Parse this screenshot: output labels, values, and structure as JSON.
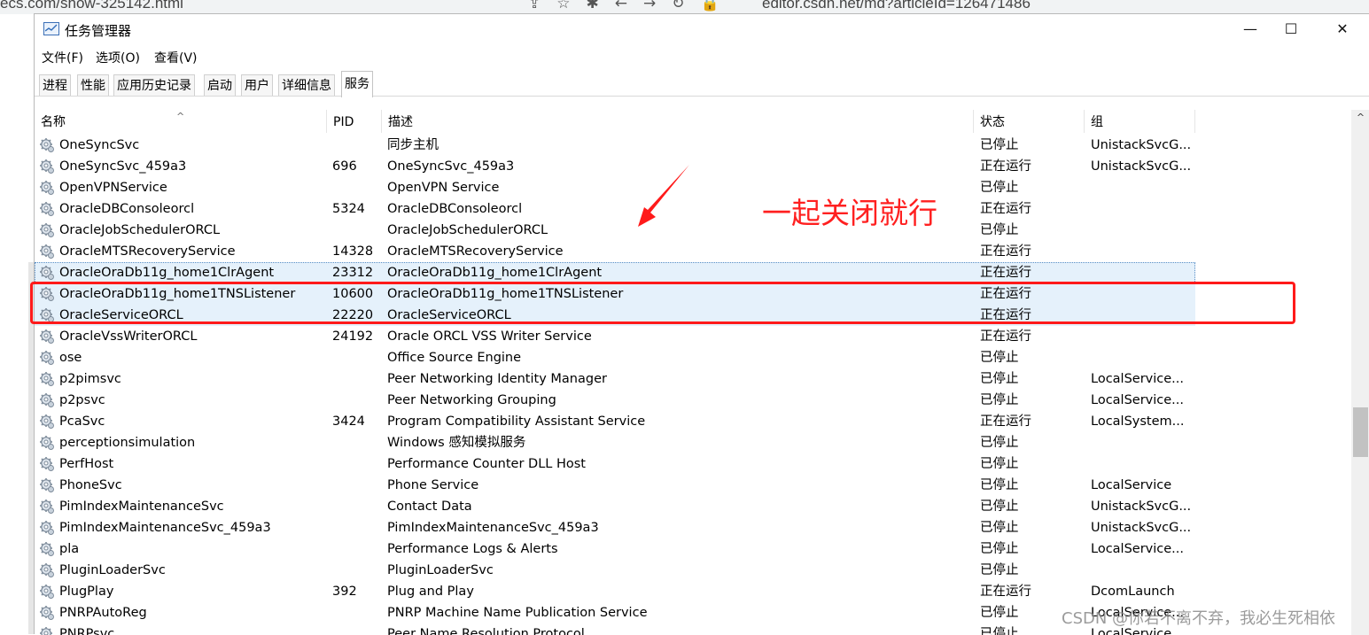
{
  "background": {
    "url_left": "ecs.com/show-325142.html",
    "url_right": "editor.csdn.net/md?articleId=126471486",
    "tool_icons": [
      "share-icon",
      "star-icon",
      "extension-icon",
      "back-icon",
      "forward-icon",
      "reload-icon",
      "lock-icon"
    ]
  },
  "window": {
    "title": "任务管理器",
    "controls": {
      "minimize": "—",
      "maximize": "☐",
      "close": "✕"
    }
  },
  "menu": [
    "文件(F)",
    "选项(O)",
    "查看(V)"
  ],
  "tabs": [
    "进程",
    "性能",
    "应用历史记录",
    "启动",
    "用户",
    "详细信息",
    "服务"
  ],
  "active_tab": "服务",
  "columns": {
    "name": "名称",
    "pid": "PID",
    "desc": "描述",
    "status": "状态",
    "group": "组"
  },
  "rows": [
    {
      "name": "OneSyncSvc",
      "pid": "",
      "desc": "同步主机",
      "status": "已停止",
      "group": "UnistackSvcG..."
    },
    {
      "name": "OneSyncSvc_459a3",
      "pid": "696",
      "desc": "OneSyncSvc_459a3",
      "status": "正在运行",
      "group": "UnistackSvcG..."
    },
    {
      "name": "OpenVPNService",
      "pid": "",
      "desc": "OpenVPN Service",
      "status": "已停止",
      "group": ""
    },
    {
      "name": "OracleDBConsoleorcl",
      "pid": "5324",
      "desc": "OracleDBConsoleorcl",
      "status": "正在运行",
      "group": ""
    },
    {
      "name": "OracleJobSchedulerORCL",
      "pid": "",
      "desc": "OracleJobSchedulerORCL",
      "status": "已停止",
      "group": ""
    },
    {
      "name": "OracleMTSRecoveryService",
      "pid": "14328",
      "desc": "OracleMTSRecoveryService",
      "status": "正在运行",
      "group": ""
    },
    {
      "name": "OracleOraDb11g_home1ClrAgent",
      "pid": "23312",
      "desc": "OracleOraDb11g_home1ClrAgent",
      "status": "正在运行",
      "group": ""
    },
    {
      "name": "OracleOraDb11g_home1TNSListener",
      "pid": "10600",
      "desc": "OracleOraDb11g_home1TNSListener",
      "status": "正在运行",
      "group": ""
    },
    {
      "name": "OracleServiceORCL",
      "pid": "22220",
      "desc": "OracleServiceORCL",
      "status": "正在运行",
      "group": ""
    },
    {
      "name": "OracleVssWriterORCL",
      "pid": "24192",
      "desc": "Oracle ORCL VSS Writer Service",
      "status": "正在运行",
      "group": ""
    },
    {
      "name": "ose",
      "pid": "",
      "desc": "Office  Source Engine",
      "status": "已停止",
      "group": ""
    },
    {
      "name": "p2pimsvc",
      "pid": "",
      "desc": "Peer Networking Identity Manager",
      "status": "已停止",
      "group": "LocalService..."
    },
    {
      "name": "p2psvc",
      "pid": "",
      "desc": "Peer Networking Grouping",
      "status": "已停止",
      "group": "LocalService..."
    },
    {
      "name": "PcaSvc",
      "pid": "3424",
      "desc": "Program Compatibility Assistant Service",
      "status": "正在运行",
      "group": "LocalSystem..."
    },
    {
      "name": "perceptionsimulation",
      "pid": "",
      "desc": "Windows 感知模拟服务",
      "status": "已停止",
      "group": ""
    },
    {
      "name": "PerfHost",
      "pid": "",
      "desc": "Performance Counter DLL Host",
      "status": "已停止",
      "group": ""
    },
    {
      "name": "PhoneSvc",
      "pid": "",
      "desc": "Phone Service",
      "status": "已停止",
      "group": "LocalService"
    },
    {
      "name": "PimIndexMaintenanceSvc",
      "pid": "",
      "desc": "Contact Data",
      "status": "已停止",
      "group": "UnistackSvcG..."
    },
    {
      "name": "PimIndexMaintenanceSvc_459a3",
      "pid": "",
      "desc": "PimIndexMaintenanceSvc_459a3",
      "status": "已停止",
      "group": "UnistackSvcG..."
    },
    {
      "name": "pla",
      "pid": "",
      "desc": "Performance Logs & Alerts",
      "status": "已停止",
      "group": "LocalService..."
    },
    {
      "name": "PluginLoaderSvc",
      "pid": "",
      "desc": "PluginLoaderSvc",
      "status": "已停止",
      "group": ""
    },
    {
      "name": "PlugPlay",
      "pid": "392",
      "desc": "Plug and Play",
      "status": "正在运行",
      "group": "DcomLaunch"
    },
    {
      "name": "PNRPAutoReg",
      "pid": "",
      "desc": "PNRP Machine Name Publication Service",
      "status": "已停止",
      "group": "LocalService..."
    },
    {
      "name": "PNRPsvc",
      "pid": "",
      "desc": "Peer Name Resolution Protocol",
      "status": "已停止",
      "group": "LocalService..."
    }
  ],
  "selected_rows": [
    6,
    7,
    8
  ],
  "annotation": {
    "text": "一起关闭就行",
    "color": "#ff2020"
  },
  "watermark": "CSDN @你若不离不弃，我必生死相依",
  "colors": {
    "selection": "#e5f1fb",
    "highlight_box": "#ff1a1a"
  }
}
